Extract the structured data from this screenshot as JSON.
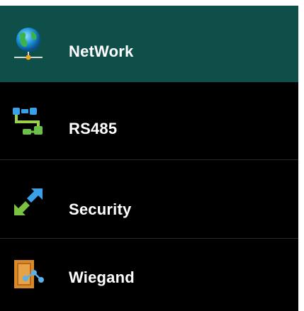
{
  "menu": {
    "items": [
      {
        "label": "NetWork",
        "icon": "globe-network-icon",
        "selected": true
      },
      {
        "label": "RS485",
        "icon": "rs485-connector-icon",
        "selected": false
      },
      {
        "label": "Security",
        "icon": "security-arrows-icon",
        "selected": false
      },
      {
        "label": "Wiegand",
        "icon": "wiegand-door-icon",
        "selected": false
      }
    ]
  },
  "colors": {
    "selected_background": "#0f4f4a",
    "background": "#000000",
    "text": "#ffffff"
  }
}
